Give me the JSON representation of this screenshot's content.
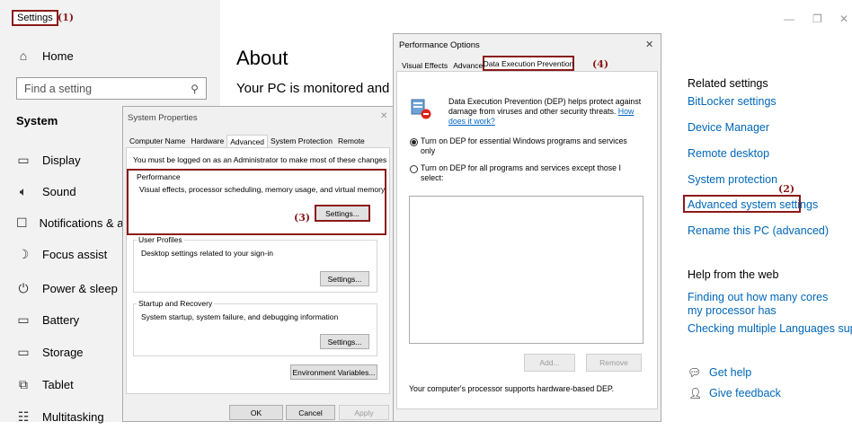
{
  "settings": {
    "window_tab": "Settings",
    "annotation_1": "(1)",
    "home": "Home",
    "search_placeholder": "Find a setting",
    "section": "System",
    "nav": [
      "Display",
      "Sound",
      "Notifications & actio",
      "Focus assist",
      "Power & sleep",
      "Battery",
      "Storage",
      "Tablet",
      "Multitasking"
    ],
    "page_title": "About",
    "page_text": "Your PC is monitored and p",
    "related_heading": "Related settings",
    "related_links": [
      "BitLocker settings",
      "Device Manager",
      "Remote desktop",
      "System protection",
      "Advanced system settings",
      "Rename this PC (advanced)"
    ],
    "annotation_2": "(2)",
    "help_heading": "Help from the web",
    "help_links": [
      "Finding out how many cores my processor has",
      "Checking multiple Languages support"
    ],
    "get_help": "Get help",
    "give_feedback": "Give feedback"
  },
  "system_properties": {
    "title": "System Properties",
    "tabs": [
      "Computer Name",
      "Hardware",
      "Advanced",
      "System Protection",
      "Remote"
    ],
    "admin_note": "You must be logged on as an Administrator to make most of these changes",
    "performance": {
      "title": "Performance",
      "text": "Visual effects, processor scheduling, memory usage, and virtual memory",
      "button": "Settings..."
    },
    "annotation_3": "(3)",
    "user_profiles": {
      "title": "User Profiles",
      "text": "Desktop settings related to your sign-in",
      "button": "Settings..."
    },
    "startup": {
      "title": "Startup and Recovery",
      "text": "System startup, system failure, and debugging information",
      "button": "Settings..."
    },
    "env_button": "Environment Variables...",
    "ok": "OK",
    "cancel": "Cancel",
    "apply": "Apply"
  },
  "performance_options": {
    "title": "Performance Options",
    "tabs": [
      "Visual Effects",
      "Advanced",
      "Data Execution Prevention"
    ],
    "annotation_4": "(4)",
    "dep_text": "Data Execution Prevention (DEP) helps protect against damage from viruses and other security threats.",
    "dep_link": "How does it work?",
    "option1": "Turn on DEP for essential Windows programs and services only",
    "option2": "Turn on DEP for all programs and services except those I select:",
    "add": "Add...",
    "remove": "Remove",
    "footer": "Your computer's processor supports hardware-based DEP."
  }
}
